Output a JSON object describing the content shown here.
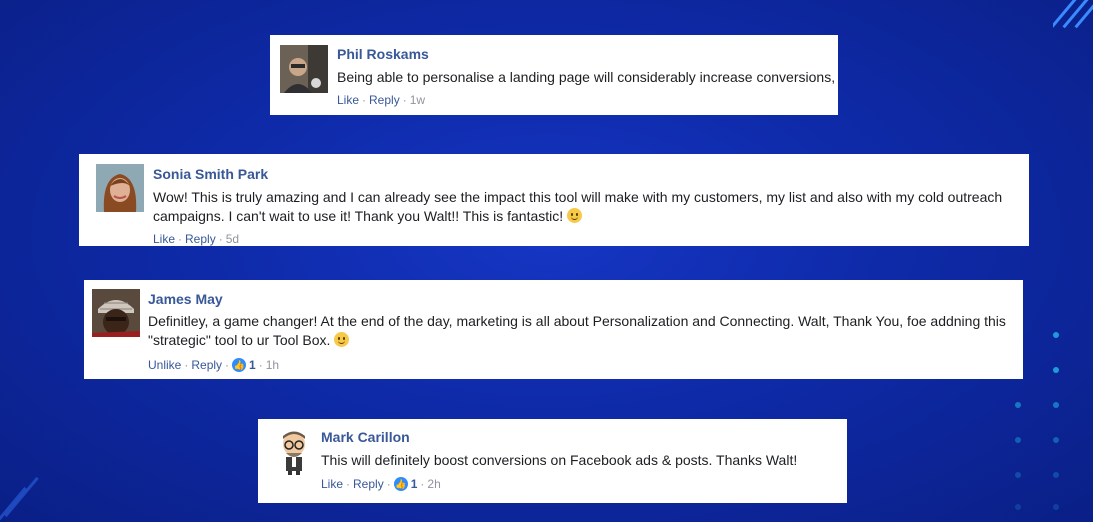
{
  "comments": [
    {
      "name": "Phil Roskams",
      "text": "Being able to personalise a landing page will considerably increase conversions,",
      "action1": "Like",
      "action2": "Reply",
      "time": "1w",
      "likes": ""
    },
    {
      "name": "Sonia Smith Park",
      "text": "Wow! This is truly amazing and I can already see the impact this tool will make with my customers, my list and also with my cold outreach campaigns. I can't wait to use it! Thank you Walt!! This is fantastic!",
      "action1": "Like",
      "action2": "Reply",
      "time": "5d",
      "likes": ""
    },
    {
      "name": "James May",
      "text": "Definitley, a game changer! At the end of the day, marketing is all about Personalization and Connecting. Walt, Thank You, foe addning this \"strategic\" tool to ur Tool Box.",
      "action1": "Unlike",
      "action2": "Reply",
      "time": "1h",
      "likes": "1"
    },
    {
      "name": "Mark Carillon",
      "text": "This will definitely boost conversions on Facebook ads & posts. Thanks Walt!",
      "action1": "Like",
      "action2": "Reply",
      "time": "2h",
      "likes": "1"
    }
  ],
  "colors": {
    "background": "#0e2aa8",
    "name": "#385898",
    "like_badge": "#2d8cff"
  },
  "icons": [
    "smile-emoji-icon",
    "thumbs-up-icon",
    "avatar-photo"
  ]
}
